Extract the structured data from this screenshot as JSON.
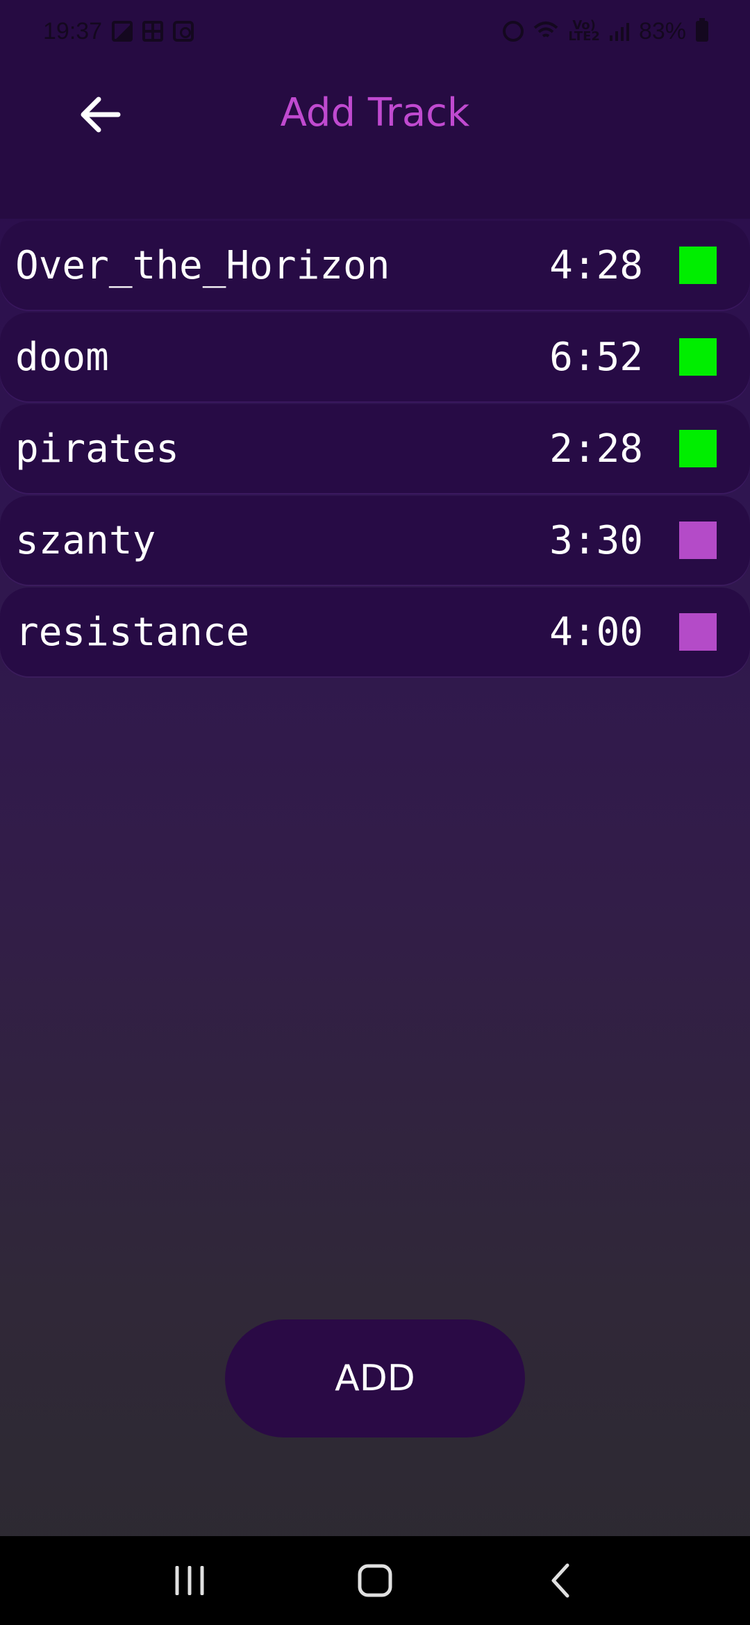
{
  "status_bar": {
    "time": "19:37",
    "network_top": "Vo)",
    "network_bottom": "LTE2",
    "battery": "83%",
    "icons": [
      "gallery-icon",
      "grid-icon",
      "media-icon",
      "alarm-icon",
      "wifi-icon",
      "signal-icon",
      "battery-icon"
    ]
  },
  "header": {
    "title": "Add Track",
    "back_icon": "arrow-left-icon"
  },
  "tracks": [
    {
      "name": "Over_the_Horizon",
      "duration": "4:28",
      "color": "#00ee00"
    },
    {
      "name": "doom",
      "duration": "6:52",
      "color": "#00ee00"
    },
    {
      "name": "pirates",
      "duration": "2:28",
      "color": "#00ee00"
    },
    {
      "name": "szanty",
      "duration": "3:30",
      "color": "#b44bc8"
    },
    {
      "name": "resistance",
      "duration": "4:00",
      "color": "#b44bc8"
    }
  ],
  "add_button": {
    "label": "ADD"
  },
  "nav_bar": {
    "icons": [
      "recent-apps-icon",
      "home-icon",
      "back-icon"
    ]
  },
  "colors": {
    "title": "#c04ad0",
    "selected": "#00ee00",
    "unselected": "#b44bc8",
    "row_bg": "#270b45"
  }
}
